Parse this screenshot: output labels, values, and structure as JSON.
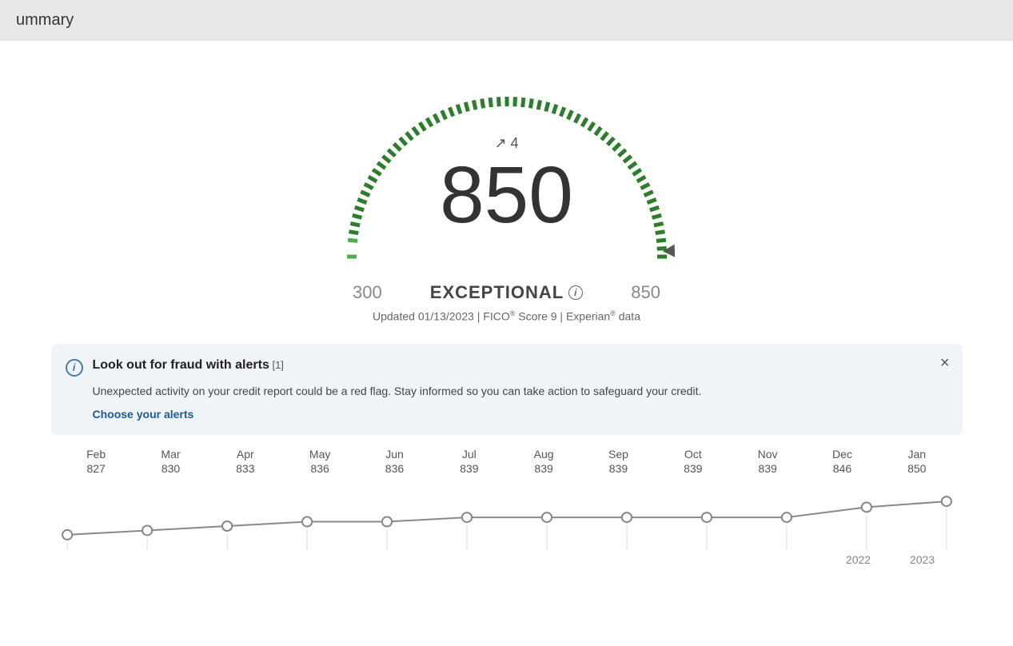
{
  "summary_bar": {
    "label": "ummary"
  },
  "score": {
    "value": "850",
    "change_label": "↗ 4",
    "status": "EXCEPTIONAL",
    "range_min": "300",
    "range_max": "850",
    "updated": "Updated 01/13/2023 | FICO",
    "fico_reg": "®",
    "score_version": " Score 9 | Experian",
    "experian_reg": "®",
    "data_label": " data"
  },
  "alert": {
    "title": "Look out for fraud with alerts",
    "ref": " [1]",
    "body": "Unexpected activity on your credit report could be a red flag. Stay informed so you can take action to safeguard your credit.",
    "link": "Choose your alerts",
    "close_label": "×"
  },
  "chart": {
    "months": [
      {
        "label": "Feb",
        "score": "827"
      },
      {
        "label": "Mar",
        "score": "830"
      },
      {
        "label": "Apr",
        "score": "833"
      },
      {
        "label": "May",
        "score": "836"
      },
      {
        "label": "Jun",
        "score": "836"
      },
      {
        "label": "Jul",
        "score": "839"
      },
      {
        "label": "Aug",
        "score": "839"
      },
      {
        "label": "Sep",
        "score": "839"
      },
      {
        "label": "Oct",
        "score": "839"
      },
      {
        "label": "Nov",
        "score": "839"
      },
      {
        "label": "Dec",
        "score": "846"
      },
      {
        "label": "Jan",
        "score": "850"
      }
    ],
    "year_labels": [
      "2022",
      "2023"
    ]
  },
  "colors": {
    "gauge_green": "#2a7a2a",
    "gauge_light": "#c8e6c9",
    "score_text": "#333333",
    "exceptional_text": "#444444"
  }
}
